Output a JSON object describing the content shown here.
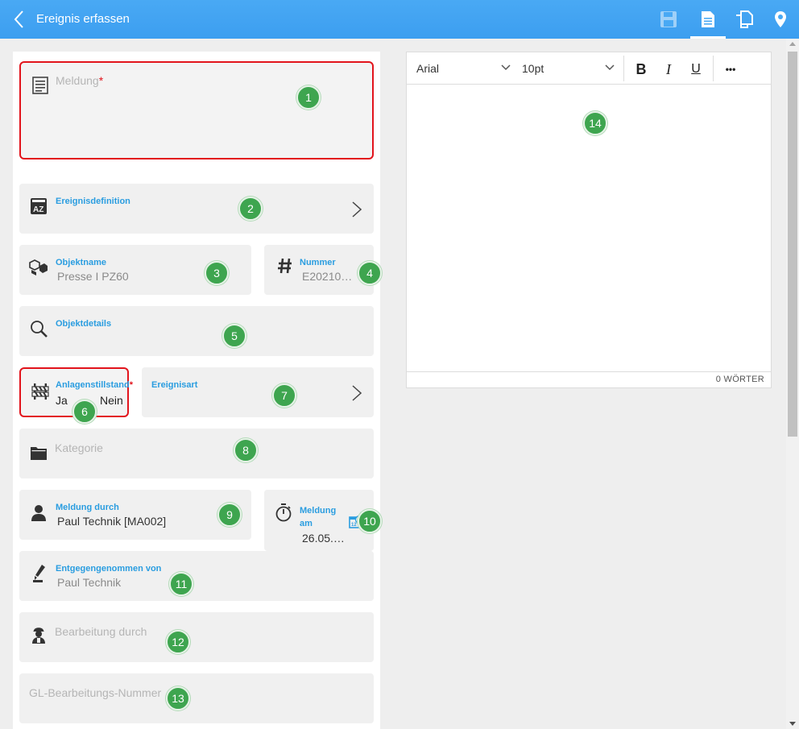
{
  "topbar": {
    "title": "Ereignis erfassen",
    "accent": "#3c9ef0",
    "icons": [
      "back-arrow-icon",
      "save-icon",
      "document-icon",
      "copy-icon",
      "location-pin-icon"
    ]
  },
  "form": {
    "meldung": {
      "label": "Meldung",
      "required": "*",
      "badge": "1"
    },
    "ereignisdefinition": {
      "label": "Ereignisdefinition",
      "badge": "2"
    },
    "objektname": {
      "label": "Objektname",
      "value": "Presse I PZ60",
      "badge": "3"
    },
    "nummer": {
      "label": "Nummer",
      "value": "E202105…",
      "badge": "4"
    },
    "objektdetails": {
      "label": "Objektdetails",
      "badge": "5"
    },
    "anlagenstillstand": {
      "label": "Anlagenstillstand",
      "required": "*",
      "yes": "Ja",
      "no": "Nein",
      "badge": "6"
    },
    "ereignisart": {
      "label": "Ereignisart",
      "badge": "7"
    },
    "kategorie": {
      "placeholder": "Kategorie",
      "badge": "8"
    },
    "meldung_durch": {
      "label": "Meldung durch",
      "value": "Paul Technik [MA002]",
      "badge": "9"
    },
    "meldung_am": {
      "label_line1": "Meldung",
      "label_line2": "am",
      "value": "26.05.…",
      "badge": "10"
    },
    "entgegengenommen": {
      "label": "Entgegengenommen von",
      "value": "Paul Technik",
      "badge": "11"
    },
    "bearbeitung_durch": {
      "placeholder": "Bearbeitung durch",
      "badge": "12"
    },
    "gl_nummer": {
      "placeholder": "GL-Bearbeitungs-Nummer",
      "badge": "13"
    }
  },
  "editor": {
    "font": "Arial",
    "size": "10pt",
    "bold": "B",
    "italic": "I",
    "underline": "U",
    "more": "•••",
    "badge": "14",
    "word_count": "0 WÖRTER"
  },
  "colors": {
    "label_blue": "#2a9de0",
    "required_red": "#e2141c",
    "badge_green": "#3ea54f"
  }
}
